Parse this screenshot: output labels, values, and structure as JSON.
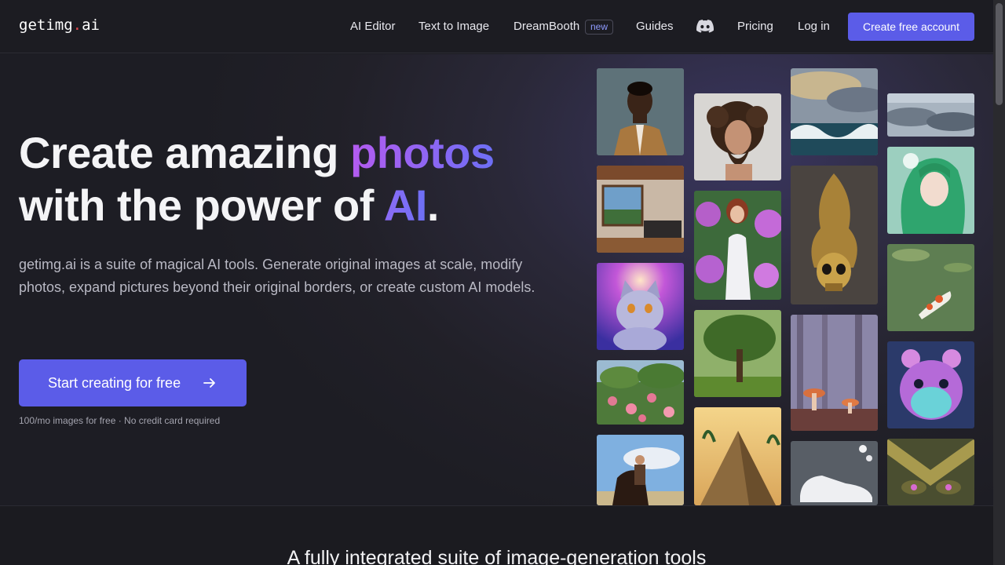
{
  "logo": {
    "main": "getimg",
    "dot": ".",
    "suffix": "ai"
  },
  "nav": {
    "ai_editor": "AI Editor",
    "text_to_image": "Text to Image",
    "dreambooth": "DreamBooth",
    "dreambooth_badge": "new",
    "guides": "Guides",
    "discord_icon": "discord-icon",
    "pricing": "Pricing",
    "login": "Log in",
    "create_account": "Create free account"
  },
  "hero": {
    "line1_prefix": "Create amazing ",
    "line1_highlight": "photos",
    "line2_prefix": "with the power of ",
    "line2_highlight": "AI",
    "line2_suffix": ".",
    "description": "getimg.ai is a suite of magical AI tools. Generate original images at scale, modify photos, expand pictures beyond their original borders, or create custom AI models.",
    "cta_label": "Start creating for free",
    "cta_icon": "arrow-right-icon",
    "note": "100/mo images for free · No credit card required"
  },
  "gallery": {
    "tiles": [
      "portrait-man-icon",
      "bedroom-icon",
      "cat-icon",
      "roses-icon",
      "horse-rider-icon",
      "curly-man-icon",
      "flower-woman-icon",
      "tree-icon",
      "pyramid-icon",
      "ocean-waves-icon",
      "golden-skull-icon",
      "mushroom-forest-icon",
      "sneaker-icon",
      "clouds-icon",
      "anime-girl-icon",
      "koi-pond-icon",
      "hamster-icon",
      "mask-icon"
    ]
  },
  "section": {
    "title": "A fully integrated suite of image-generation tools"
  },
  "colors": {
    "accent": "#5b5ce8",
    "background": "#1b1b21",
    "highlight_start": "#b45bf0",
    "highlight_end": "#6d6ff5"
  }
}
